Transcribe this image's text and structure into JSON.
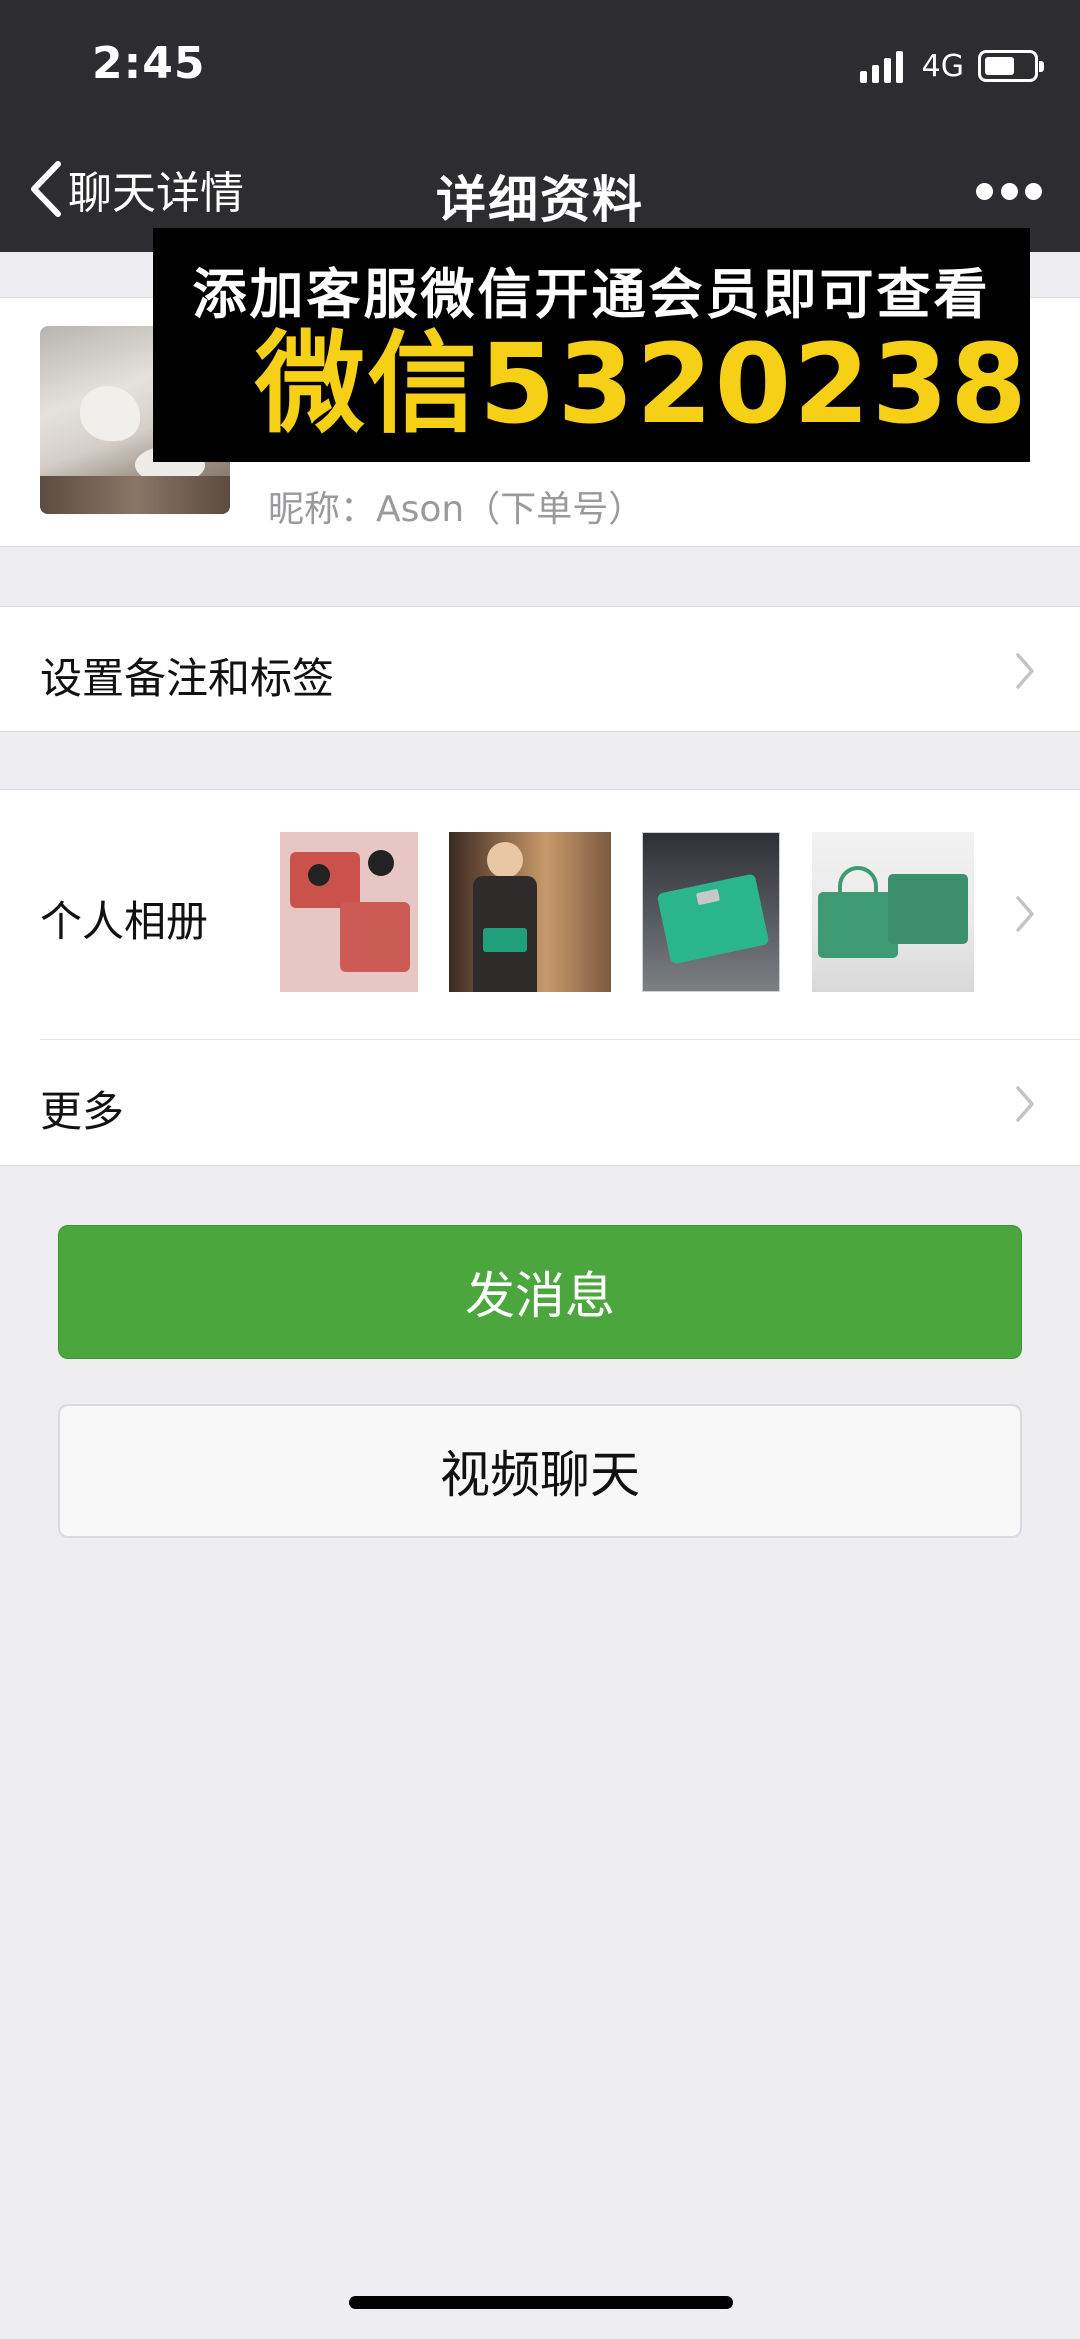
{
  "status_bar": {
    "time": "2:45",
    "network": "4G",
    "battery_level": 0.62,
    "signal_bars": 4
  },
  "nav": {
    "back_label": "聊天详情",
    "title": "详细资料",
    "more_icon": "more-dots-icon"
  },
  "profile": {
    "nickname": "昵称：Ason（下单号）"
  },
  "promo": {
    "line1": "添加客服微信开通会员即可查看",
    "line2": "微信5320238"
  },
  "cells": {
    "remark_label": "设置备注和标签",
    "album_label": "个人相册",
    "more_label": "更多"
  },
  "buttons": {
    "send_message": "发消息",
    "video_chat": "视频聊天"
  },
  "colors": {
    "nav_bg": "#2c2c31",
    "page_bg": "#ededf2",
    "send_button": "#4aa63d",
    "promo_yellow": "#f5d016"
  }
}
